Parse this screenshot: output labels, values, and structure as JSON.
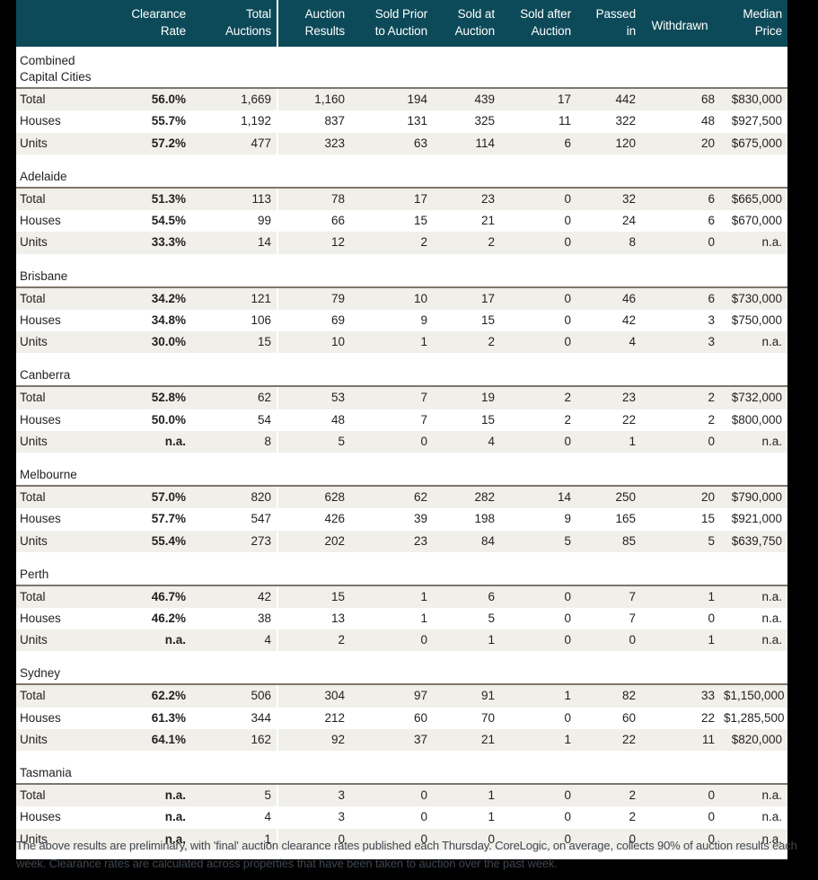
{
  "table": {
    "columns": [
      {
        "label": "",
        "key": "property_type",
        "align": "left"
      },
      {
        "label": "Clearance\nRate",
        "key": "clearance_rate",
        "align": "right"
      },
      {
        "label": "Total\nAuctions",
        "key": "total_auctions",
        "align": "right"
      },
      {
        "label": "Auction\nResults",
        "key": "auction_results",
        "align": "right"
      },
      {
        "label": "Sold Prior\nto Auction",
        "key": "sold_prior",
        "align": "right"
      },
      {
        "label": "Sold at\nAuction",
        "key": "sold_at",
        "align": "right"
      },
      {
        "label": "Sold after\nAuction",
        "key": "sold_after",
        "align": "right"
      },
      {
        "label": "Passed\nin",
        "key": "passed_in",
        "align": "right"
      },
      {
        "label": "Withdrawn",
        "key": "withdrawn",
        "align": "center"
      },
      {
        "label": "Median\nPrice",
        "key": "median_price",
        "align": "right"
      }
    ],
    "header_colors": {
      "background": "#0d4a59",
      "text": "#ffffff",
      "separator": "#ffffff"
    },
    "row_colors": {
      "shaded": "#f0efe9",
      "plain": "#ffffff",
      "rule": "#7d766c",
      "text": "#231f20"
    },
    "page_background": "#000000",
    "groups": [
      {
        "name": "Combined\nCapital Cities",
        "rows": [
          {
            "property_type": "Total",
            "clearance_rate": "56.0%",
            "total_auctions": "1,669",
            "auction_results": "1,160",
            "sold_prior": "194",
            "sold_at": "439",
            "sold_after": "17",
            "passed_in": "442",
            "withdrawn": "68",
            "median_price": "$830,000"
          },
          {
            "property_type": "Houses",
            "clearance_rate": "55.7%",
            "total_auctions": "1,192",
            "auction_results": "837",
            "sold_prior": "131",
            "sold_at": "325",
            "sold_after": "11",
            "passed_in": "322",
            "withdrawn": "48",
            "median_price": "$927,500"
          },
          {
            "property_type": "Units",
            "clearance_rate": "57.2%",
            "total_auctions": "477",
            "auction_results": "323",
            "sold_prior": "63",
            "sold_at": "114",
            "sold_after": "6",
            "passed_in": "120",
            "withdrawn": "20",
            "median_price": "$675,000"
          }
        ]
      },
      {
        "name": "Adelaide",
        "rows": [
          {
            "property_type": "Total",
            "clearance_rate": "51.3%",
            "total_auctions": "113",
            "auction_results": "78",
            "sold_prior": "17",
            "sold_at": "23",
            "sold_after": "0",
            "passed_in": "32",
            "withdrawn": "6",
            "median_price": "$665,000"
          },
          {
            "property_type": "Houses",
            "clearance_rate": "54.5%",
            "total_auctions": "99",
            "auction_results": "66",
            "sold_prior": "15",
            "sold_at": "21",
            "sold_after": "0",
            "passed_in": "24",
            "withdrawn": "6",
            "median_price": "$670,000"
          },
          {
            "property_type": "Units",
            "clearance_rate": "33.3%",
            "total_auctions": "14",
            "auction_results": "12",
            "sold_prior": "2",
            "sold_at": "2",
            "sold_after": "0",
            "passed_in": "8",
            "withdrawn": "0",
            "median_price": "n.a."
          }
        ]
      },
      {
        "name": "Brisbane",
        "rows": [
          {
            "property_type": "Total",
            "clearance_rate": "34.2%",
            "total_auctions": "121",
            "auction_results": "79",
            "sold_prior": "10",
            "sold_at": "17",
            "sold_after": "0",
            "passed_in": "46",
            "withdrawn": "6",
            "median_price": "$730,000"
          },
          {
            "property_type": "Houses",
            "clearance_rate": "34.8%",
            "total_auctions": "106",
            "auction_results": "69",
            "sold_prior": "9",
            "sold_at": "15",
            "sold_after": "0",
            "passed_in": "42",
            "withdrawn": "3",
            "median_price": "$750,000"
          },
          {
            "property_type": "Units",
            "clearance_rate": "30.0%",
            "total_auctions": "15",
            "auction_results": "10",
            "sold_prior": "1",
            "sold_at": "2",
            "sold_after": "0",
            "passed_in": "4",
            "withdrawn": "3",
            "median_price": "n.a."
          }
        ]
      },
      {
        "name": "Canberra",
        "rows": [
          {
            "property_type": "Total",
            "clearance_rate": "52.8%",
            "total_auctions": "62",
            "auction_results": "53",
            "sold_prior": "7",
            "sold_at": "19",
            "sold_after": "2",
            "passed_in": "23",
            "withdrawn": "2",
            "median_price": "$732,000"
          },
          {
            "property_type": "Houses",
            "clearance_rate": "50.0%",
            "total_auctions": "54",
            "auction_results": "48",
            "sold_prior": "7",
            "sold_at": "15",
            "sold_after": "2",
            "passed_in": "22",
            "withdrawn": "2",
            "median_price": "$800,000"
          },
          {
            "property_type": "Units",
            "clearance_rate": "n.a.",
            "total_auctions": "8",
            "auction_results": "5",
            "sold_prior": "0",
            "sold_at": "4",
            "sold_after": "0",
            "passed_in": "1",
            "withdrawn": "0",
            "median_price": "n.a."
          }
        ]
      },
      {
        "name": "Melbourne",
        "rows": [
          {
            "property_type": "Total",
            "clearance_rate": "57.0%",
            "total_auctions": "820",
            "auction_results": "628",
            "sold_prior": "62",
            "sold_at": "282",
            "sold_after": "14",
            "passed_in": "250",
            "withdrawn": "20",
            "median_price": "$790,000"
          },
          {
            "property_type": "Houses",
            "clearance_rate": "57.7%",
            "total_auctions": "547",
            "auction_results": "426",
            "sold_prior": "39",
            "sold_at": "198",
            "sold_after": "9",
            "passed_in": "165",
            "withdrawn": "15",
            "median_price": "$921,000"
          },
          {
            "property_type": "Units",
            "clearance_rate": "55.4%",
            "total_auctions": "273",
            "auction_results": "202",
            "sold_prior": "23",
            "sold_at": "84",
            "sold_after": "5",
            "passed_in": "85",
            "withdrawn": "5",
            "median_price": "$639,750"
          }
        ]
      },
      {
        "name": "Perth",
        "rows": [
          {
            "property_type": "Total",
            "clearance_rate": "46.7%",
            "total_auctions": "42",
            "auction_results": "15",
            "sold_prior": "1",
            "sold_at": "6",
            "sold_after": "0",
            "passed_in": "7",
            "withdrawn": "1",
            "median_price": "n.a."
          },
          {
            "property_type": "Houses",
            "clearance_rate": "46.2%",
            "total_auctions": "38",
            "auction_results": "13",
            "sold_prior": "1",
            "sold_at": "5",
            "sold_after": "0",
            "passed_in": "7",
            "withdrawn": "0",
            "median_price": "n.a."
          },
          {
            "property_type": "Units",
            "clearance_rate": "n.a.",
            "total_auctions": "4",
            "auction_results": "2",
            "sold_prior": "0",
            "sold_at": "1",
            "sold_after": "0",
            "passed_in": "0",
            "withdrawn": "1",
            "median_price": "n.a."
          }
        ]
      },
      {
        "name": "Sydney",
        "rows": [
          {
            "property_type": "Total",
            "clearance_rate": "62.2%",
            "total_auctions": "506",
            "auction_results": "304",
            "sold_prior": "97",
            "sold_at": "91",
            "sold_after": "1",
            "passed_in": "82",
            "withdrawn": "33",
            "median_price": "$1,150,000"
          },
          {
            "property_type": "Houses",
            "clearance_rate": "61.3%",
            "total_auctions": "344",
            "auction_results": "212",
            "sold_prior": "60",
            "sold_at": "70",
            "sold_after": "0",
            "passed_in": "60",
            "withdrawn": "22",
            "median_price": "$1,285,500"
          },
          {
            "property_type": "Units",
            "clearance_rate": "64.1%",
            "total_auctions": "162",
            "auction_results": "92",
            "sold_prior": "37",
            "sold_at": "21",
            "sold_after": "1",
            "passed_in": "22",
            "withdrawn": "11",
            "median_price": "$820,000"
          }
        ]
      },
      {
        "name": "Tasmania",
        "rows": [
          {
            "property_type": "Total",
            "clearance_rate": "n.a.",
            "total_auctions": "5",
            "auction_results": "3",
            "sold_prior": "0",
            "sold_at": "1",
            "sold_after": "0",
            "passed_in": "2",
            "withdrawn": "0",
            "median_price": "n.a."
          },
          {
            "property_type": "Houses",
            "clearance_rate": "n.a.",
            "total_auctions": "4",
            "auction_results": "3",
            "sold_prior": "0",
            "sold_at": "1",
            "sold_after": "0",
            "passed_in": "2",
            "withdrawn": "0",
            "median_price": "n.a."
          },
          {
            "property_type": "Units",
            "clearance_rate": "n.a.",
            "total_auctions": "1",
            "auction_results": "0",
            "sold_prior": "0",
            "sold_at": "0",
            "sold_after": "0",
            "passed_in": "0",
            "withdrawn": "0",
            "median_price": "n.a."
          }
        ]
      }
    ]
  },
  "footer": {
    "note": "The above results are preliminary, with 'final' auction clearance rates published each Thursday. CoreLogic, on average, collects 90% of auction results each week. Clearance rates are calculated across properties that have been taken to auction over the past week."
  }
}
